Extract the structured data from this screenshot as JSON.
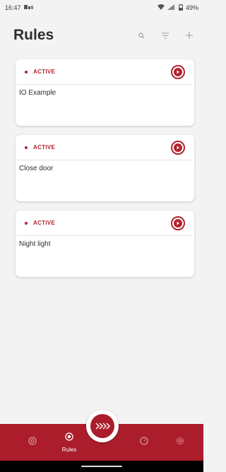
{
  "status_bar": {
    "time": "16:47",
    "battery": "49%"
  },
  "header": {
    "title": "Rules"
  },
  "rules": [
    {
      "status": "ACTIVE",
      "name": "IO Example"
    },
    {
      "status": "ACTIVE",
      "name": "Close door"
    },
    {
      "status": "ACTIVE",
      "name": "Night light"
    }
  ],
  "nav": {
    "active_label": "Rules"
  },
  "colors": {
    "accent": "#ab1d2b",
    "active_status": "#b3232e",
    "background": "#f3f3f3"
  }
}
